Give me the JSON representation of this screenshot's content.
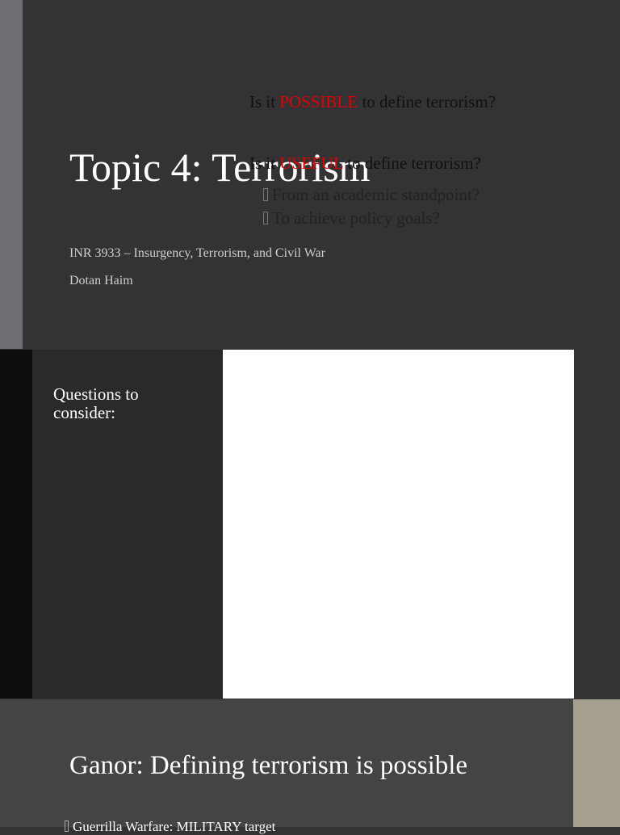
{
  "slide1": {
    "title": "Topic 4: Terrorism",
    "subtitle": "INR 3933 – Insurgency, Terrorism, and Civil War",
    "author": "Dotan Haim"
  },
  "slide2": {
    "sidebar_heading": "Questions to consider:",
    "q1": {
      "pre": "Is it ",
      "em": "POSSIBLE",
      "post": " to define terrorism?"
    },
    "q2": {
      "pre": "Is it ",
      "em": "USEFUL",
      "post": " to define terrorism?"
    },
    "bullets": [
      "From an academic standpoint?",
      "To achieve policy goals?"
    ]
  },
  "slide3": {
    "title": "Ganor: Defining terrorism is possible",
    "bullets": [
      "Guerrilla Warfare: MILITARY target"
    ]
  },
  "colors": {
    "accent_red": "#e00000"
  }
}
